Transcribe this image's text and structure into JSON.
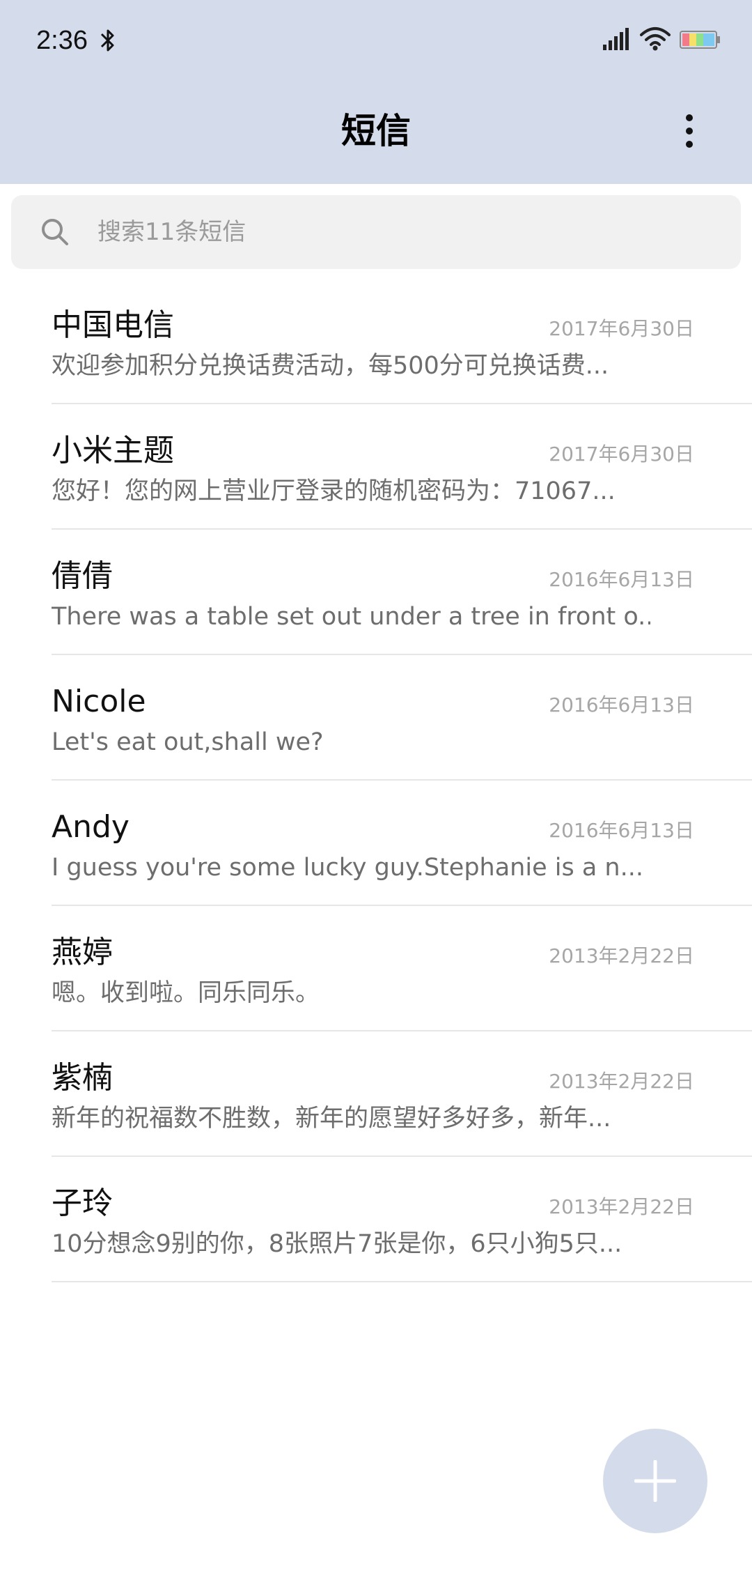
{
  "status_bar": {
    "time": "2:36",
    "icons": [
      "bluetooth-icon",
      "signal-icon",
      "wifi-icon",
      "battery-icon"
    ]
  },
  "header": {
    "title": "短信",
    "more_icon": "more-vertical-icon"
  },
  "search": {
    "placeholder": "搜索11条短信",
    "icon": "search-icon"
  },
  "messages": [
    {
      "sender": "中国电信",
      "date": "2017年6月30日",
      "preview": "欢迎参加积分兑换话费活动，每500分可兑换话费..."
    },
    {
      "sender": "小米主题",
      "date": "2017年6月30日",
      "preview": "您好！您的网上营业厅登录的随机密码为：71067..."
    },
    {
      "sender": "倩倩",
      "date": "2016年6月13日",
      "preview": "There was a table set out under a tree in front o..."
    },
    {
      "sender": "Nicole",
      "date": "2016年6月13日",
      "preview": "Let's eat out,shall we?"
    },
    {
      "sender": "Andy",
      "date": "2016年6月13日",
      "preview": "I guess you're some lucky guy.Stephanie is a n..."
    },
    {
      "sender": "燕婷",
      "date": "2013年2月22日",
      "preview": "嗯。收到啦。同乐同乐。"
    },
    {
      "sender": "紫楠",
      "date": "2013年2月22日",
      "preview": "新年的祝福数不胜数，新年的愿望好多好多，新年..."
    },
    {
      "sender": "子玲",
      "date": "2013年2月22日",
      "preview": "10分想念9别的你，8张照片7张是你，6只小狗5只..."
    }
  ],
  "compose": {
    "icon": "plus-icon"
  },
  "colors": {
    "header_bg": "#d4dbeb",
    "compose_bg": "#d4dbeb",
    "search_bg": "#f1f1f1",
    "divider": "#e6e6e6"
  }
}
